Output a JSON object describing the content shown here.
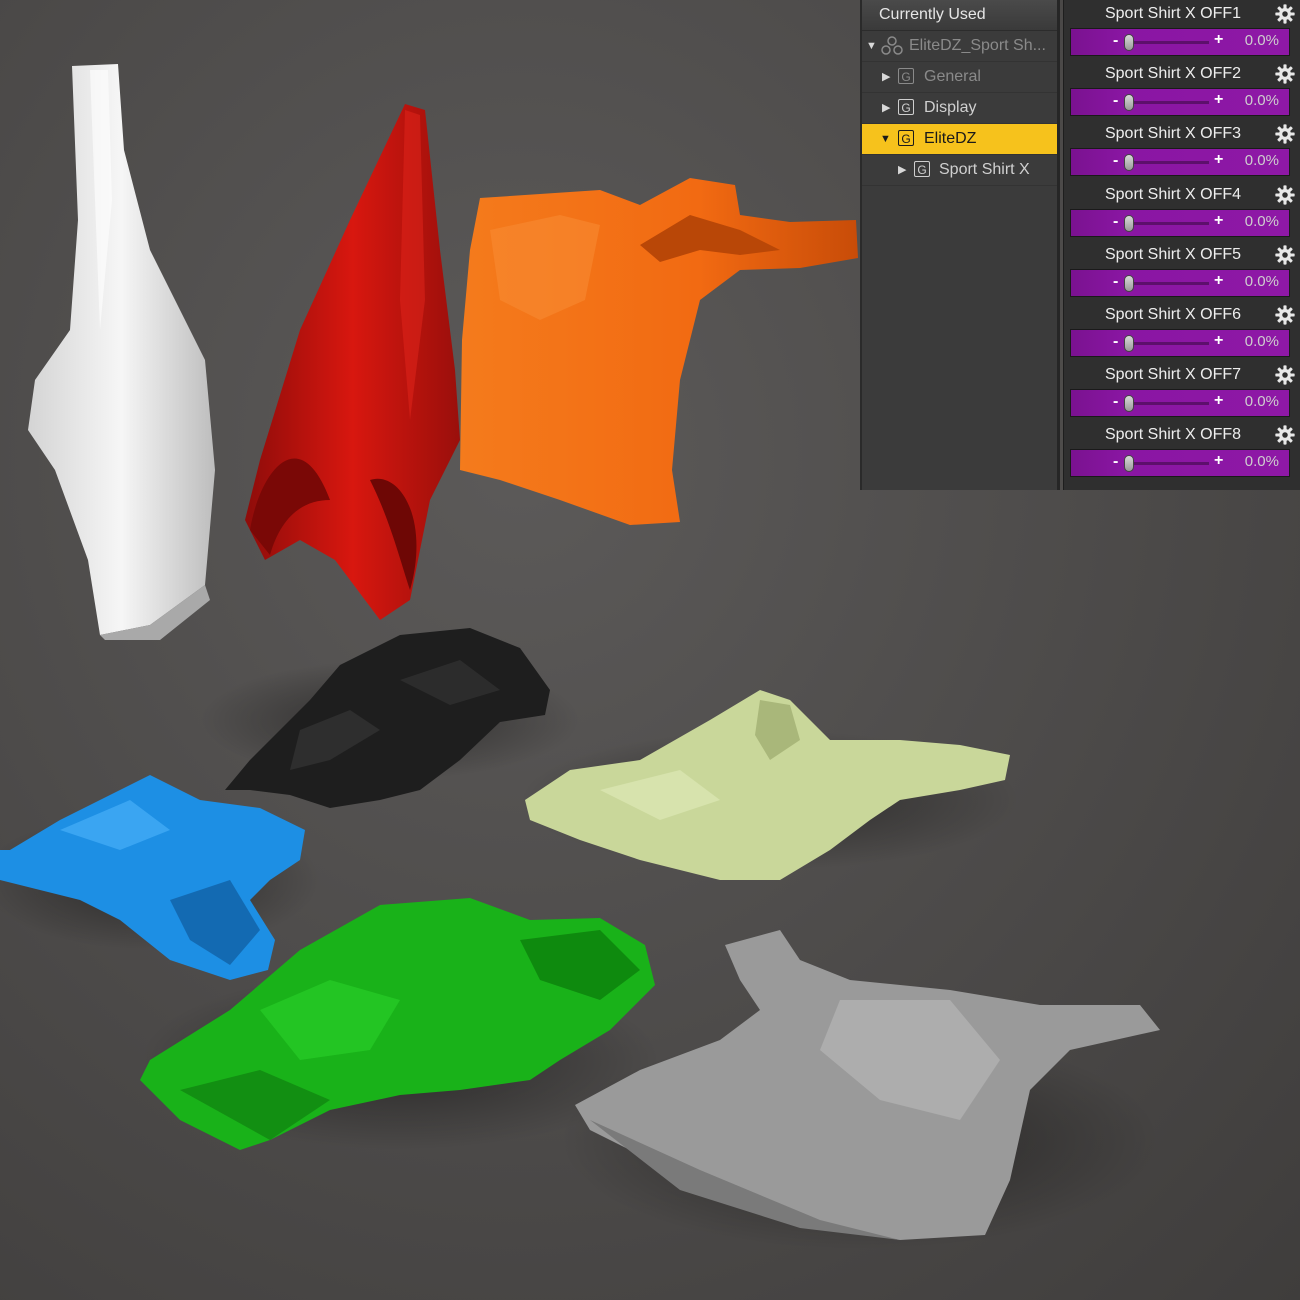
{
  "scene": {
    "garments": [
      {
        "name": "white-tank-top",
        "color": "#e8e8e8"
      },
      {
        "name": "red-tank-top",
        "color": "#c8140f"
      },
      {
        "name": "orange-tank-top",
        "color": "#f26a12"
      },
      {
        "name": "black-tank-top",
        "color": "#1e1e1e"
      },
      {
        "name": "blue-tank-top",
        "color": "#1d8fe4"
      },
      {
        "name": "green-tank-top",
        "color": "#19b219"
      },
      {
        "name": "pale-green-tank-top",
        "color": "#c9d79a"
      },
      {
        "name": "grey-tank-top",
        "color": "#9a9a9a"
      }
    ]
  },
  "tree": {
    "header": "Currently Used",
    "root_label": "EliteDZ_Sport Sh...",
    "items": [
      {
        "label": "General",
        "expanded": false,
        "dim": true
      },
      {
        "label": "Display",
        "expanded": false,
        "dim": false
      },
      {
        "label": "EliteDZ",
        "expanded": true,
        "selected": true
      },
      {
        "label": "Sport Shirt X",
        "expanded": false,
        "dim": false
      }
    ],
    "group_icon_glyph": "G"
  },
  "sliders": [
    {
      "label": "Sport Shirt X OFF1",
      "value": "0.0%",
      "level": 0.0
    },
    {
      "label": "Sport Shirt X OFF2",
      "value": "0.0%",
      "level": 0.0
    },
    {
      "label": "Sport Shirt X OFF3",
      "value": "0.0%",
      "level": 0.0
    },
    {
      "label": "Sport Shirt X OFF4",
      "value": "0.0%",
      "level": 0.0
    },
    {
      "label": "Sport Shirt X OFF5",
      "value": "0.0%",
      "level": 0.0
    },
    {
      "label": "Sport Shirt X OFF6",
      "value": "0.0%",
      "level": 0.0
    },
    {
      "label": "Sport Shirt X OFF7",
      "value": "0.0%",
      "level": 0.0
    },
    {
      "label": "Sport Shirt X OFF8",
      "value": "0.0%",
      "level": 0.0
    }
  ],
  "slider_controls": {
    "minus": "-",
    "plus": "+",
    "icon": "gear-icon"
  },
  "colors": {
    "selection": "#f6c21c",
    "slider_fill": "#8e18a6"
  }
}
